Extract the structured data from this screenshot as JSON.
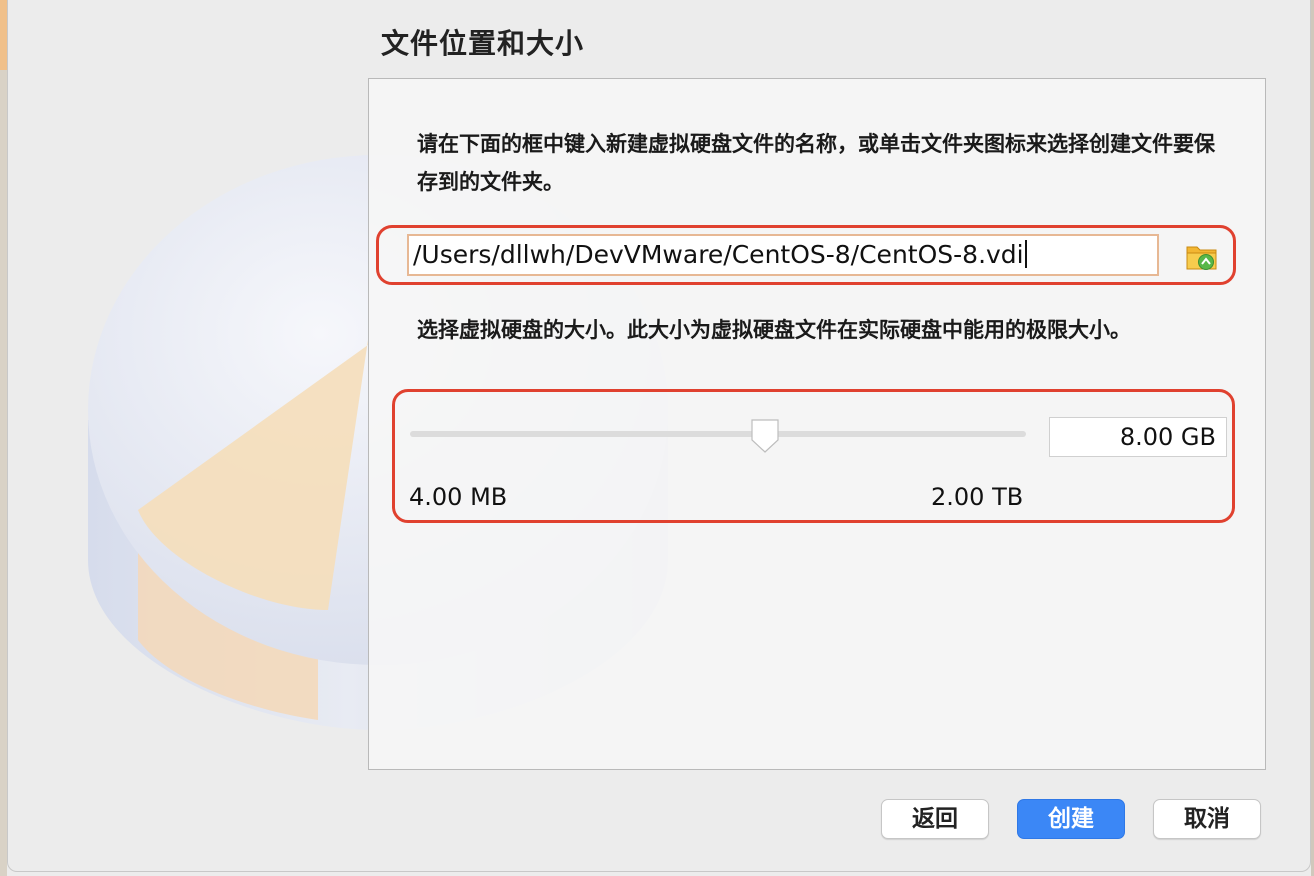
{
  "page": {
    "title": "文件位置和大小"
  },
  "location": {
    "description": "请在下面的框中键入新建虚拟硬盘文件的名称，或单击文件夹图标来选择创建文件要保存到的文件夹。",
    "path": "/Users/dllwh/DevVMware/CentOS-8/CentOS-8.vdi",
    "folder_icon": "folder-browse-icon"
  },
  "size": {
    "description": "选择虚拟硬盘的大小。此大小为虚拟硬盘文件在实际硬盘中能用的极限大小。",
    "value": "8.00 GB",
    "min_label": "4.00 MB",
    "max_label": "2.00 TB",
    "slider_fraction": 0.58
  },
  "buttons": {
    "back": "返回",
    "create": "创建",
    "cancel": "取消"
  },
  "colors": {
    "highlight": "#e0412f",
    "primary": "#3b87f6"
  }
}
